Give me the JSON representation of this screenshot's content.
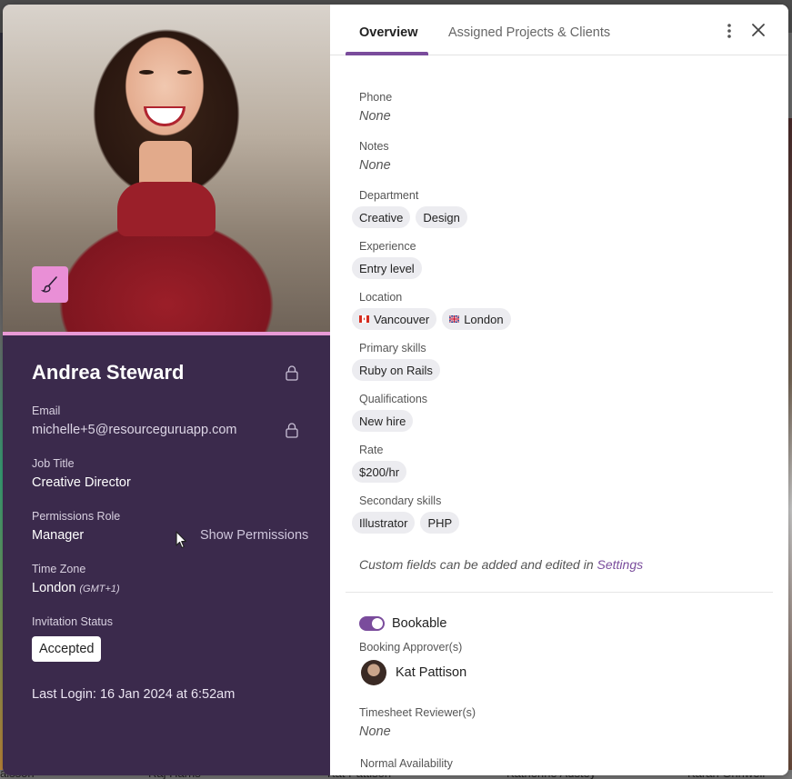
{
  "background": {
    "bottom_names": [
      "alsson",
      "Raj Harris",
      "Kat Pattison",
      "Katherine Austey",
      "Karan Grinwell"
    ]
  },
  "profile": {
    "name": "Andrea Steward",
    "email_label": "Email",
    "email": "michelle+5@resourceguruapp.com",
    "job_title_label": "Job Title",
    "job_title": "Creative Director",
    "permissions_label": "Permissions Role",
    "permissions_role": "Manager",
    "show_permissions": "Show Permissions",
    "timezone_label": "Time Zone",
    "timezone": "London",
    "timezone_offset": "(GMT+1)",
    "invitation_label": "Invitation Status",
    "invitation_status": "Accepted",
    "last_login": "Last Login: 16 Jan 2024 at 6:52am"
  },
  "tabs": [
    {
      "label": "Overview",
      "active": true
    },
    {
      "label": "Assigned Projects & Clients",
      "active": false
    }
  ],
  "overview": {
    "phone_label": "Phone",
    "phone": "None",
    "notes_label": "Notes",
    "notes": "None",
    "department_label": "Department",
    "department": [
      "Creative",
      "Design"
    ],
    "experience_label": "Experience",
    "experience": [
      "Entry level"
    ],
    "location_label": "Location",
    "location": [
      "Vancouver",
      "London"
    ],
    "primary_skills_label": "Primary skills",
    "primary_skills": [
      "Ruby on Rails"
    ],
    "qualifications_label": "Qualifications",
    "qualifications": [
      "New hire"
    ],
    "rate_label": "Rate",
    "rate": [
      "$200/hr"
    ],
    "secondary_skills_label": "Secondary skills",
    "secondary_skills": [
      "Illustrator",
      "PHP"
    ],
    "custom_note": "Custom fields can be added and edited in ",
    "settings_link": "Settings",
    "bookable_label": "Bookable",
    "bookable": true,
    "approvers_label": "Booking Approver(s)",
    "approver_name": "Kat Pattison",
    "reviewers_label": "Timesheet Reviewer(s)",
    "reviewers": "None",
    "availability_label": "Normal Availability"
  },
  "colors": {
    "panel": "#3b2a4c",
    "accent": "#7a4c9c",
    "badge_pink": "#e98fd6"
  }
}
